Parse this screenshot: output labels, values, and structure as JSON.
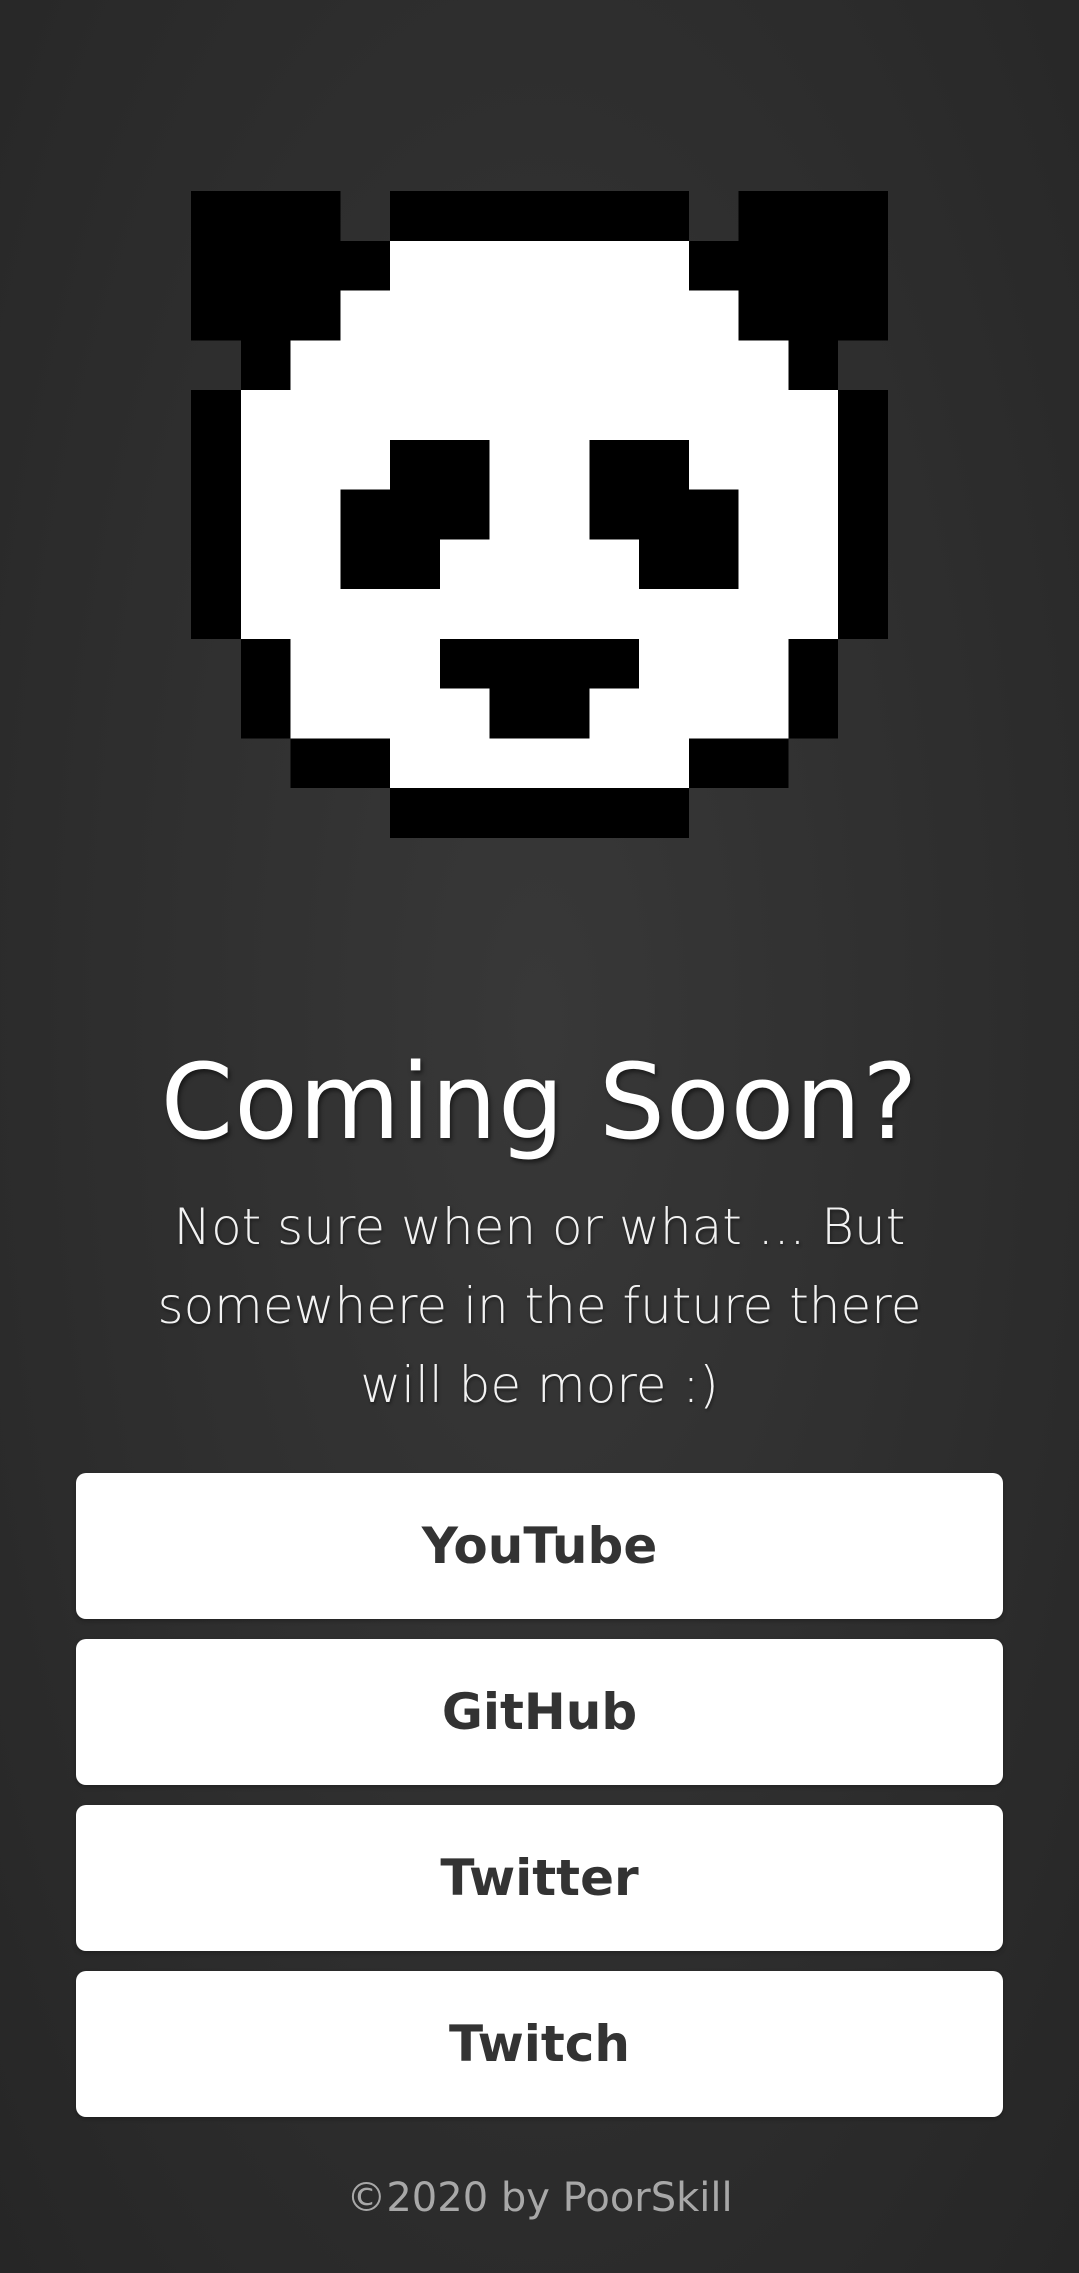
{
  "logo": {
    "icon": "pixel-panda-icon",
    "colors": {
      "black": "#000000",
      "white": "#ffffff"
    }
  },
  "heading": {
    "title": "Coming Soon?",
    "subtitle": "Not sure when or what ... But somewhere in the future there will be more :)"
  },
  "links": [
    {
      "label": "YouTube"
    },
    {
      "label": "GitHub"
    },
    {
      "label": "Twitter"
    },
    {
      "label": "Twitch"
    }
  ],
  "footer": {
    "text": "©2020 by PoorSkill"
  },
  "colors": {
    "background": "#303030",
    "button_background": "#ffffff",
    "button_text": "#333333",
    "footer_text": "#a8a8a8"
  }
}
